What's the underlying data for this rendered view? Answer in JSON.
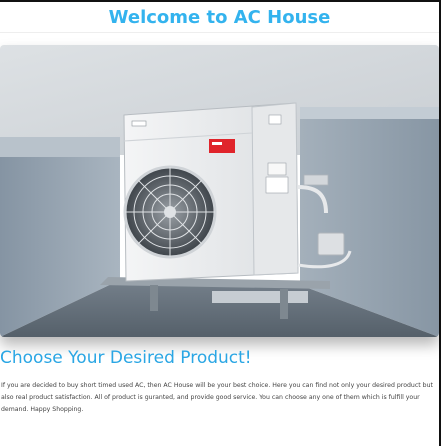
{
  "header": {
    "title": "Welcome to AC House"
  },
  "hero": {
    "image_alt": "Outdoor air conditioner unit mounted on a wall bracket",
    "brand_sticker_color": "#e0242b"
  },
  "content": {
    "heading": "Choose Your Desired Product!",
    "description": "If you are decided to buy short timed used AC, then AC House will be your best choice. Here you can find not only your desired product but also real product satisfaction. All of product is guranted, and provide good service. You can choose any one of them which is fulfill your demand. Happy Shopping."
  },
  "colors": {
    "title": "#33b3ee",
    "heading": "#2aa6e4",
    "text": "#444444"
  }
}
